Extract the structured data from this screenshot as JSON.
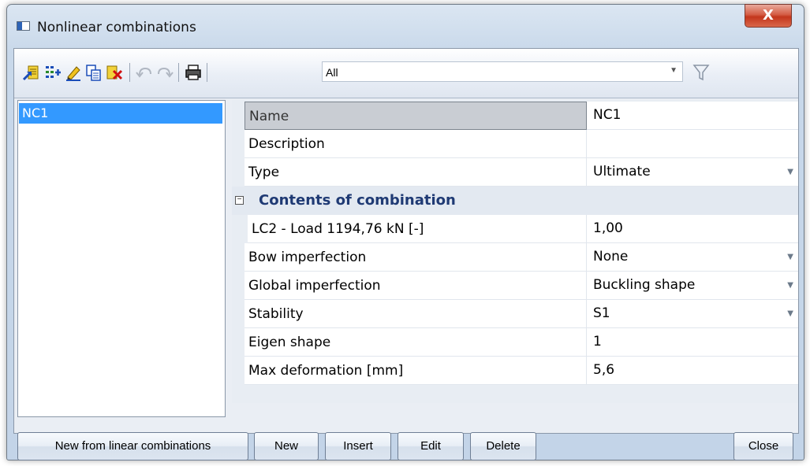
{
  "window": {
    "title": "Nonlinear combinations",
    "close_label": "X"
  },
  "toolbar": {
    "icons": [
      "new-icon",
      "input-icon",
      "edit-icon",
      "copy-icon",
      "delete-icon",
      "undo-icon",
      "redo-icon",
      "print-icon",
      "filter-icon"
    ],
    "filter_value": "All"
  },
  "list": {
    "items": [
      "NC1"
    ]
  },
  "properties": {
    "rows": [
      {
        "name": "Name",
        "value": "NC1"
      },
      {
        "name": "Description",
        "value": ""
      },
      {
        "name": "Type",
        "value": "Ultimate"
      },
      {
        "section": "Contents of combination"
      },
      {
        "name": "LC2 - Load 1194,76 kN [-]",
        "value": "1,00"
      },
      {
        "name": "Bow imperfection",
        "value": "None"
      },
      {
        "name": "Global imperfection",
        "value": "Buckling shape"
      },
      {
        "name": "Stability",
        "value": "S1"
      },
      {
        "name": "Eigen shape",
        "value": "1"
      },
      {
        "name": "Max deformation [mm]",
        "value": "5,6"
      }
    ]
  },
  "buttons": {
    "new_from_linear": "New from linear combinations",
    "new": "New",
    "insert": "Insert",
    "edit": "Edit",
    "delete": "Delete",
    "close": "Close"
  },
  "colors": {
    "selection": "#3399ff",
    "section_title": "#1f3a74",
    "close_button": "#c3361c"
  }
}
